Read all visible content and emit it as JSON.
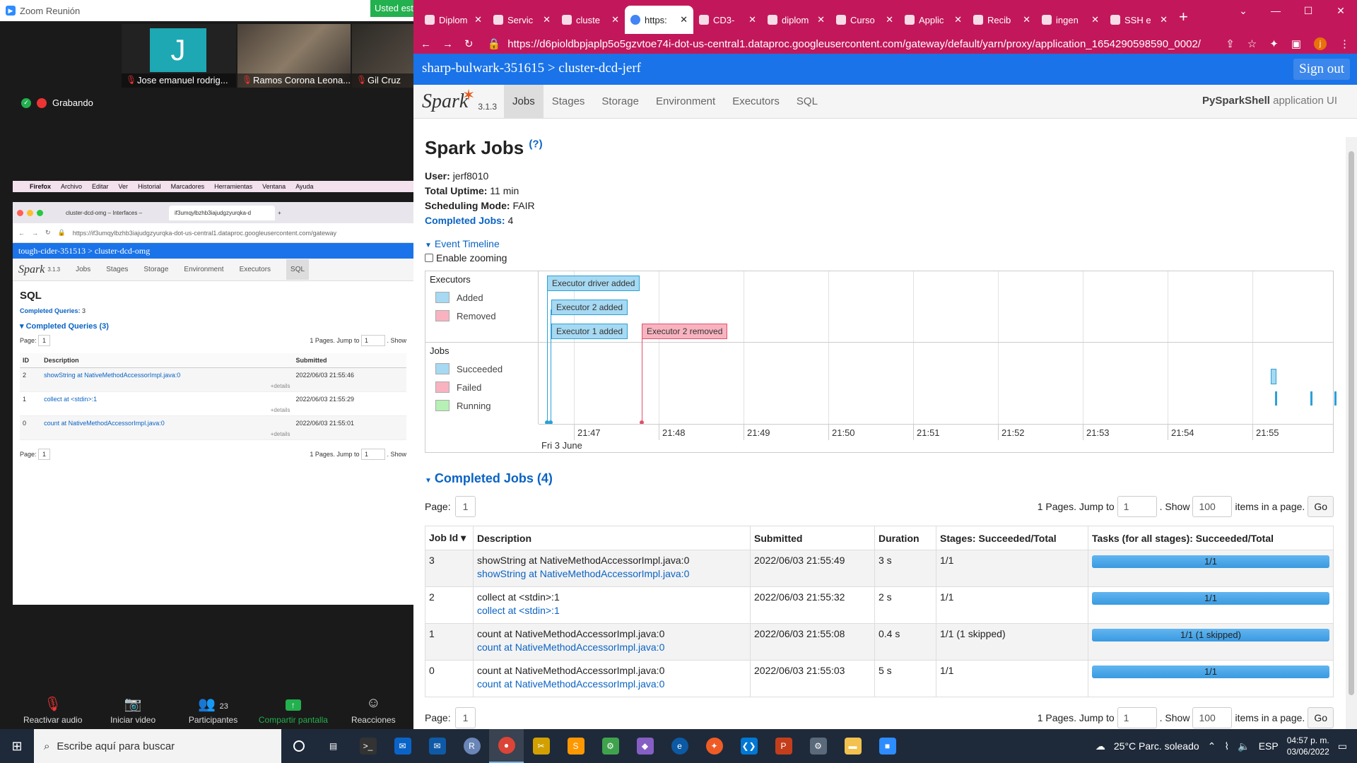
{
  "zoom": {
    "window_title": "Zoom Reunión",
    "sharing_banner": "Usted está compartiendo",
    "participants": [
      {
        "initial": "J",
        "name": "Jose emanuel rodrig..."
      },
      {
        "name": "Ramos Corona Leona..."
      },
      {
        "name": "Gil Cruz"
      }
    ],
    "recording_label": "Grabando",
    "toolbar": [
      {
        "label": "Reactivar audio",
        "icon": "mic-muted-icon"
      },
      {
        "label": "Iniciar video",
        "icon": "video-off-icon"
      },
      {
        "label": "Participantes",
        "icon": "participants-icon",
        "count": "23"
      },
      {
        "label": "Compartir pantalla",
        "icon": "share-screen-icon"
      },
      {
        "label": "Reacciones",
        "icon": "reactions-icon"
      }
    ]
  },
  "mac_menubar": {
    "items": [
      "Firefox",
      "Archivo",
      "Editar",
      "Ver",
      "Historial",
      "Marcadores",
      "Herramientas",
      "Ventana",
      "Ayuda"
    ]
  },
  "shared_browser": {
    "tabs": [
      "cluster-dcd-omg – Interfaces –",
      "if3umqylbzhb3iajudgzyurqka-d"
    ],
    "url": "https://if3umqylbzhb3iajudgzyurqka-dot-us-central1.dataproc.googleusercontent.com/gateway",
    "breadcrumb": "tough-cider-351513 > cluster-dcd-omg",
    "spark_version": "3.1.3",
    "nav": [
      "Jobs",
      "Stages",
      "Storage",
      "Environment",
      "Executors",
      "SQL"
    ],
    "title": "SQL",
    "completed_queries_label": "Completed Queries:",
    "completed_queries_value": "3",
    "section": "Completed Queries (3)",
    "page_label": "Page:",
    "page_value": "1",
    "pager_text": "1 Pages. Jump to",
    "jump_value": "1",
    "show_label": ". Show",
    "columns": [
      "ID",
      "Description",
      "Submitted"
    ],
    "rows": [
      {
        "id": "2",
        "desc": "showString at NativeMethodAccessorImpl.java:0",
        "submitted": "2022/06/03 21:55:46",
        "details": "+details"
      },
      {
        "id": "1",
        "desc": "collect at <stdin>:1",
        "submitted": "2022/06/03 21:55:29",
        "details": "+details"
      },
      {
        "id": "0",
        "desc": "count at NativeMethodAccessorImpl.java:0",
        "submitted": "2022/06/03 21:55:01",
        "details": "+details"
      }
    ]
  },
  "chrome": {
    "tabs": [
      {
        "label": "Diplom",
        "icon": "gmail-icon"
      },
      {
        "label": "Servic",
        "icon": "cloud-icon"
      },
      {
        "label": "cluste",
        "icon": "dataproc-icon"
      },
      {
        "label": "https:",
        "icon": "chrome-icon",
        "active": true
      },
      {
        "label": "CD3-",
        "icon": "drive-icon"
      },
      {
        "label": "diplom",
        "icon": "github-icon"
      },
      {
        "label": "Curso",
        "icon": "course-icon"
      },
      {
        "label": "Applic",
        "icon": "app-icon"
      },
      {
        "label": "Recib",
        "icon": "gmail-icon"
      },
      {
        "label": "ingen",
        "icon": "c-icon"
      },
      {
        "label": "SSH e",
        "icon": "chrome-icon"
      }
    ],
    "url": "https://d6pioldbpjaplp5o5gzvtoe74i-dot-us-central1.dataproc.googleusercontent.com/gateway/default/yarn/proxy/application_1654290598590_0002/"
  },
  "spark": {
    "breadcrumb": "sharp-bulwark-351615  >  cluster-dcd-jerf",
    "sign_out": "Sign out",
    "version": "3.1.3",
    "nav": [
      "Jobs",
      "Stages",
      "Storage",
      "Environment",
      "Executors",
      "SQL"
    ],
    "app_name": "PySparkShell",
    "app_suffix": " application UI",
    "title": "Spark Jobs",
    "help": "(?)",
    "user_label": "User:",
    "user": "jerf8010",
    "uptime_label": "Total Uptime:",
    "uptime": "11 min",
    "mode_label": "Scheduling Mode:",
    "mode": "FAIR",
    "completed_label": "Completed Jobs:",
    "completed": "4",
    "event_timeline": "Event Timeline",
    "enable_zooming": "Enable zooming",
    "timeline": {
      "executors_label": "Executors",
      "jobs_label": "Jobs",
      "legend_executors": [
        {
          "label": "Added",
          "color": "#a6d9f2"
        },
        {
          "label": "Removed",
          "color": "#f9b3c0"
        }
      ],
      "legend_jobs": [
        {
          "label": "Succeeded",
          "color": "#a6d9f2"
        },
        {
          "label": "Failed",
          "color": "#f9b3c0"
        },
        {
          "label": "Running",
          "color": "#b5f0b5"
        }
      ],
      "events": [
        "Executor driver added",
        "Executor 2 added",
        "Executor 1 added",
        "Executor 2 removed"
      ],
      "ticks": [
        "21:47",
        "21:48",
        "21:49",
        "21:50",
        "21:51",
        "21:52",
        "21:53",
        "21:54",
        "21:55"
      ],
      "date": "Fri 3 June"
    },
    "completed_section": "Completed Jobs (4)",
    "page_label": "Page:",
    "page_value": "1",
    "pages_text": "1 Pages. Jump to",
    "jump_value": "1",
    "show_label": ". Show",
    "show_value": "100",
    "items_text": "items in a page.",
    "go": "Go",
    "columns": [
      "Job Id ▾",
      "Description",
      "Submitted",
      "Duration",
      "Stages: Succeeded/Total",
      "Tasks (for all stages): Succeeded/Total"
    ],
    "jobs": [
      {
        "id": "3",
        "desc": "showString at NativeMethodAccessorImpl.java:0",
        "link": "showString at NativeMethodAccessorImpl.java:0",
        "submitted": "2022/06/03 21:55:49",
        "duration": "3 s",
        "stages": "1/1",
        "tasks": "1/1"
      },
      {
        "id": "2",
        "desc": "collect at <stdin>:1",
        "link": "collect at <stdin>:1",
        "submitted": "2022/06/03 21:55:32",
        "duration": "2 s",
        "stages": "1/1",
        "tasks": "1/1"
      },
      {
        "id": "1",
        "desc": "count at NativeMethodAccessorImpl.java:0",
        "link": "count at NativeMethodAccessorImpl.java:0",
        "submitted": "2022/06/03 21:55:08",
        "duration": "0.4 s",
        "stages": "1/1 (1 skipped)",
        "tasks": "1/1 (1 skipped)"
      },
      {
        "id": "0",
        "desc": "count at NativeMethodAccessorImpl.java:0",
        "link": "count at NativeMethodAccessorImpl.java:0",
        "submitted": "2022/06/03 21:55:03",
        "duration": "5 s",
        "stages": "1/1",
        "tasks": "1/1"
      }
    ]
  },
  "taskbar": {
    "search_placeholder": "Escribe aquí para buscar",
    "weather": "25°C  Parc. soleado",
    "lang": "ESP",
    "time": "04:57 p. m.",
    "date": "03/06/2022"
  }
}
